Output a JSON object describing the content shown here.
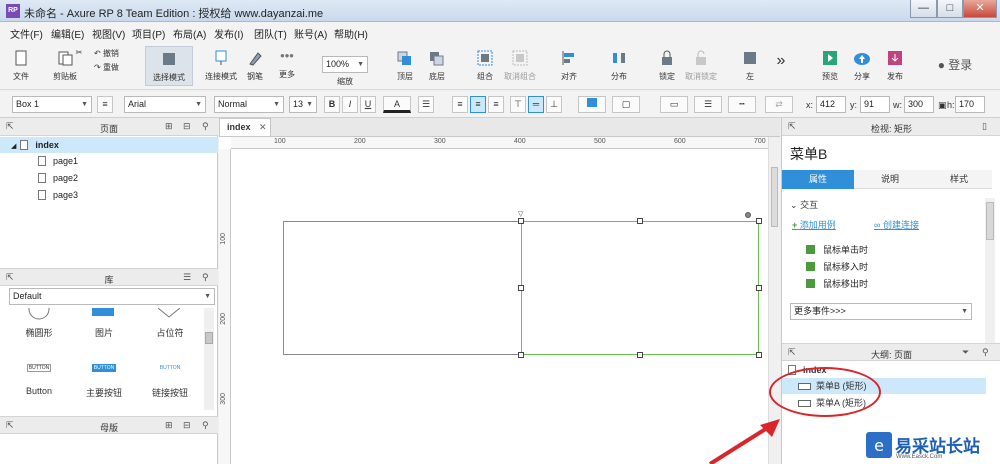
{
  "window": {
    "logo": "RP",
    "title": "未命名 - Axure RP 8 Team Edition : 授权给 www.dayanzai.me",
    "min": "—",
    "max": "□",
    "close": "✕"
  },
  "menu": [
    "文件(F)",
    "编辑(E)",
    "视图(V)",
    "项目(P)",
    "布局(A)",
    "发布(I)",
    "团队(T)",
    "账号(A)",
    "帮助(H)"
  ],
  "toolbar": {
    "file": "文件",
    "clipboard": "剪贴板",
    "undo": "撤销",
    "redo": "重做",
    "select_mode": "选择模式",
    "connect_mode": "连接模式",
    "pen": "钢笔",
    "more": "更多",
    "zoom_value": "100%",
    "zoom_label": "缩放",
    "top": "顶层",
    "bottom": "底层",
    "group": "组合",
    "ungroup": "取消组合",
    "align": "对齐",
    "distribute": "分布",
    "lock": "锁定",
    "unlock": "取消锁定",
    "left": "左",
    "overflow": "»",
    "preview": "预览",
    "share": "分享",
    "publish": "发布",
    "login": "登录"
  },
  "format": {
    "widget_name": "Box 1",
    "font": "Arial",
    "weight": "Normal",
    "size": "13",
    "bold": "B",
    "italic": "I",
    "underline": "U",
    "font_color": "A",
    "x_label": "x:",
    "x": "412",
    "y_label": "y:",
    "y": "91",
    "w_label": "w:",
    "w": "300",
    "h_label": "h:",
    "h": "170"
  },
  "pages_panel": {
    "title": "页面",
    "root": "index",
    "children": [
      "page1",
      "page2",
      "page3"
    ]
  },
  "library_panel": {
    "title": "库",
    "selected": "Default",
    "items": [
      {
        "label": "椭圆形"
      },
      {
        "label": "图片"
      },
      {
        "label": "占位符"
      },
      {
        "label": "Button",
        "preview": "BUTTON"
      },
      {
        "label": "主要按钮",
        "preview": "BUTTON"
      },
      {
        "label": "链接按钮",
        "preview": "BUTTON"
      }
    ]
  },
  "masters_panel": {
    "title": "母版"
  },
  "canvas": {
    "tab": "index",
    "ruler_h": [
      "100",
      "200",
      "300",
      "400",
      "500",
      "600",
      "700"
    ],
    "ruler_v": [
      "100",
      "200",
      "300"
    ]
  },
  "inspector": {
    "header": "检视: 矩形",
    "widget_name": "菜单B",
    "tabs": [
      "属性",
      "说明",
      "样式"
    ],
    "section": "交互",
    "add_case": "添加用例",
    "create_link": "创建连接",
    "events": [
      "鼠标单击时",
      "鼠标移入时",
      "鼠标移出时"
    ],
    "more_events": "更多事件>>>"
  },
  "outline": {
    "title": "大纲: 页面",
    "root": "index",
    "items": [
      "菜单B (矩形)",
      "菜单A (矩形)"
    ]
  },
  "watermark": {
    "text": "易采站长站",
    "url": "Www.Easck.Com"
  },
  "colors": {
    "accent": "#2f8fd8",
    "selection": "#cde8fa",
    "green": "#6abf4b",
    "annotation": "#d9262b"
  }
}
